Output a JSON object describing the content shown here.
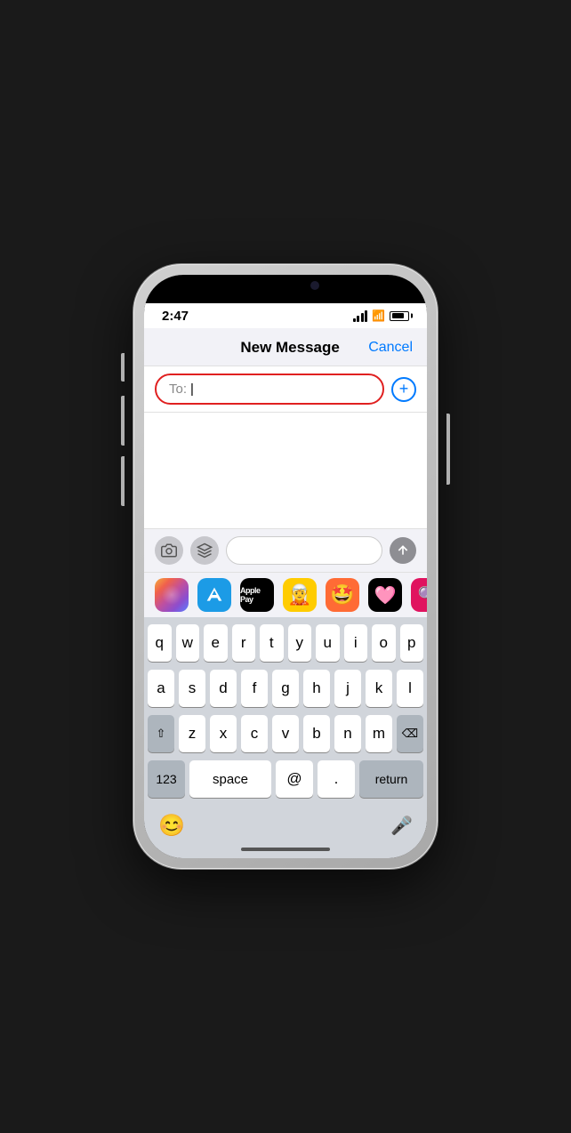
{
  "status": {
    "time": "2:47",
    "signal_bars": [
      4,
      7,
      10,
      13
    ],
    "battery_label": "Battery"
  },
  "header": {
    "title": "New Message",
    "cancel_label": "Cancel"
  },
  "to_field": {
    "label": "To:",
    "placeholder": ""
  },
  "toolbar": {
    "send_label": "Send"
  },
  "app_strip": {
    "apps": [
      {
        "name": "Photos",
        "icon": "photos"
      },
      {
        "name": "App Store",
        "icon": "appstore"
      },
      {
        "name": "Apple Pay",
        "icon": "applepay",
        "label": "Apple Pay"
      },
      {
        "name": "Memoji 1",
        "icon": "memoji1"
      },
      {
        "name": "Memoji 2",
        "icon": "memoji2"
      },
      {
        "name": "Heart App",
        "icon": "heart"
      },
      {
        "name": "Search App",
        "icon": "search"
      }
    ]
  },
  "keyboard": {
    "rows": [
      [
        "q",
        "w",
        "e",
        "r",
        "t",
        "y",
        "u",
        "i",
        "o",
        "p"
      ],
      [
        "a",
        "s",
        "d",
        "f",
        "g",
        "h",
        "j",
        "k",
        "l"
      ],
      [
        "z",
        "x",
        "c",
        "v",
        "b",
        "n",
        "m"
      ]
    ],
    "bottom_left": "123",
    "space_label": "space",
    "at_label": "@",
    "period_label": ".",
    "return_label": "return",
    "emoji_icon": "😊",
    "mic_icon": "🎤"
  }
}
